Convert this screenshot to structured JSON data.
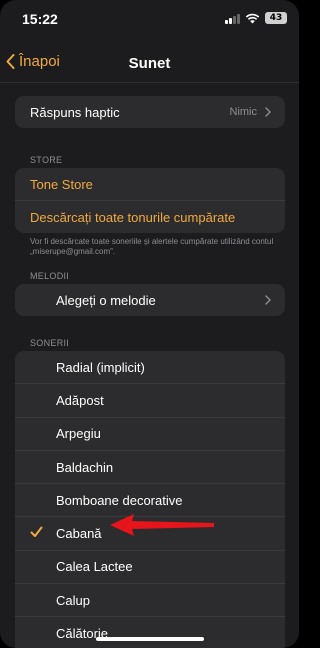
{
  "status_bar": {
    "time": "15:22",
    "battery": "43"
  },
  "nav": {
    "back_label": "Înapoi",
    "title": "Sunet"
  },
  "haptic": {
    "label": "Răspuns haptic",
    "value": "Nimic"
  },
  "store": {
    "header": "STORE",
    "items": [
      {
        "label": "Tone Store"
      },
      {
        "label": "Descărcați toate tonurile cumpărate"
      }
    ],
    "footnote": "Vor fi descărcate toate soneriile și alertele cumpărate utilizând contul „miserupe@gmail.com”."
  },
  "melodies": {
    "header": "MELODII",
    "item_label": "Alegeți o melodie"
  },
  "ringtones": {
    "header": "SONERII",
    "selected_index": 5,
    "items": [
      {
        "label": "Radial (implicit)"
      },
      {
        "label": "Adăpost"
      },
      {
        "label": "Arpegiu"
      },
      {
        "label": "Baldachin"
      },
      {
        "label": "Bomboane decorative"
      },
      {
        "label": "Cabană"
      },
      {
        "label": "Calea Lactee"
      },
      {
        "label": "Calup"
      },
      {
        "label": "Călătorie"
      }
    ]
  },
  "colors": {
    "accent": "#f0a93e",
    "annotation_arrow": "#e8141b",
    "background": "#1c1c1e",
    "group": "#2c2c2e"
  },
  "icons": {
    "back": "chevron-left-icon",
    "disclosure": "chevron-right-icon",
    "selected": "checkmark-icon",
    "annotation": "red-arrow-icon"
  }
}
